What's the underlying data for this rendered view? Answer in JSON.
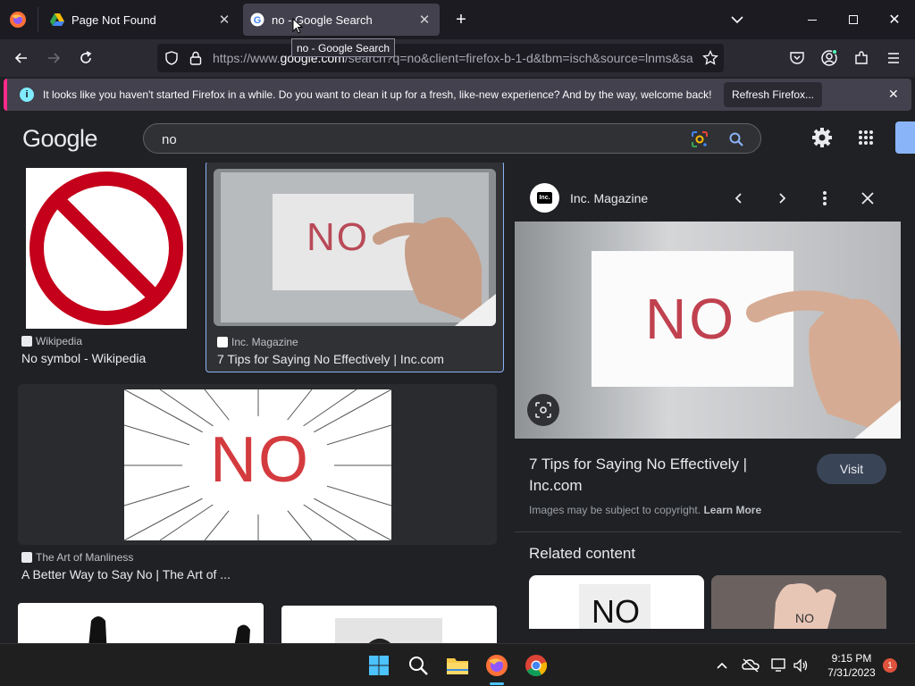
{
  "browser": {
    "tabs": [
      {
        "title": "Page Not Found",
        "active": false
      },
      {
        "title": "no - Google Search",
        "active": true
      }
    ],
    "tooltip": "no - Google Search",
    "url_prefix": "https://www.",
    "url_domain": "google.com",
    "url_rest": "/search?q=no&client=firefox-b-1-d&tbm=isch&source=lnms&sa",
    "notification": {
      "message": "It looks like you haven't started Firefox in a while. Do you want to clean it up for a fresh, like-new experience? And by the way, welcome back!",
      "button": "Refresh Firefox..."
    }
  },
  "google": {
    "logo": "Google",
    "query": "no"
  },
  "results": [
    {
      "source": "Wikipedia",
      "caption": "No symbol - Wikipedia"
    },
    {
      "source": "Inc. Magazine",
      "caption": "7 Tips for Saying No Effectively | Inc.com",
      "selected": true
    },
    {
      "source": "The Art of Manliness",
      "caption": "A Better Way to Say No | The Art of ..."
    }
  ],
  "image_text": {
    "no": "NO"
  },
  "panel": {
    "source": "Inc. Magazine",
    "logo_text": "Inc.",
    "title": "7 Tips for Saying No Effectively | Inc.com",
    "visit": "Visit",
    "copyright": "Images may be subject to copyright.",
    "learn_more": "Learn More",
    "related": "Related content"
  },
  "taskbar": {
    "time": "9:15 PM",
    "date": "7/31/2023",
    "badge": "1"
  },
  "colors": {
    "accent_blue": "#8ab4f8",
    "firefox_pink": "#ff2a8a",
    "no_red": "#c0392b"
  }
}
